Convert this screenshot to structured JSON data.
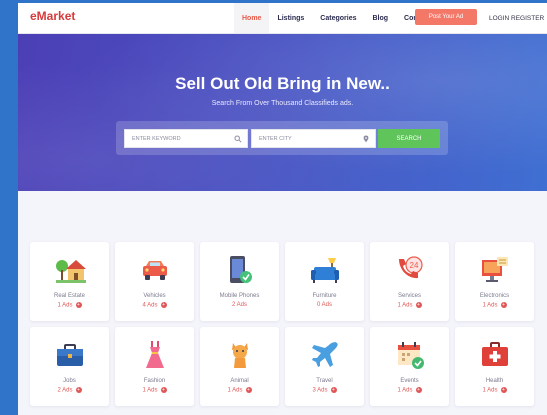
{
  "brand": "eMarket",
  "nav": {
    "items": [
      "Home",
      "Listings",
      "Categories",
      "Blog",
      "Contact"
    ],
    "active": "Home",
    "post_ad": "Post Your Ad",
    "login": "LOGIN",
    "register": "REGISTER"
  },
  "hero": {
    "title": "Sell Out Old Bring in New..",
    "subtitle": "Search From Over Thousand Classifieds ads.",
    "keyword_placeholder": "ENTER KEYWORD",
    "city_placeholder": "ENTER CITY",
    "search_button": "SEARCH"
  },
  "categories": [
    {
      "name": "Real Estate",
      "ads": "1 Ads",
      "icon": "house-icon"
    },
    {
      "name": "Vehicles",
      "ads": "4 Ads",
      "icon": "car-icon"
    },
    {
      "name": "Mobile Phones",
      "ads": "2 Ads",
      "icon": "mobile-phone-icon"
    },
    {
      "name": "Furniture",
      "ads": "0 Ads",
      "icon": "sofa-icon"
    },
    {
      "name": "Services",
      "ads": "1 Ads",
      "icon": "phone-24-icon"
    },
    {
      "name": "Electronics",
      "ads": "1 Ads",
      "icon": "monitor-icon"
    },
    {
      "name": "Jobs",
      "ads": "2 Ads",
      "icon": "briefcase-icon"
    },
    {
      "name": "Fashion",
      "ads": "1 Ads",
      "icon": "dress-icon"
    },
    {
      "name": "Animal",
      "ads": "1 Ads",
      "icon": "cat-icon"
    },
    {
      "name": "Travel",
      "ads": "3 Ads",
      "icon": "airplane-icon"
    },
    {
      "name": "Events",
      "ads": "1 Ads",
      "icon": "calendar-icon"
    },
    {
      "name": "Health",
      "ads": "1 Ads",
      "icon": "first-aid-icon"
    }
  ],
  "colors": {
    "brand": "#d63a3a",
    "active_nav": "#e65a4a",
    "post_button": "#f37868",
    "search_button": "#5fc45a",
    "ads_count": "#e05757"
  }
}
